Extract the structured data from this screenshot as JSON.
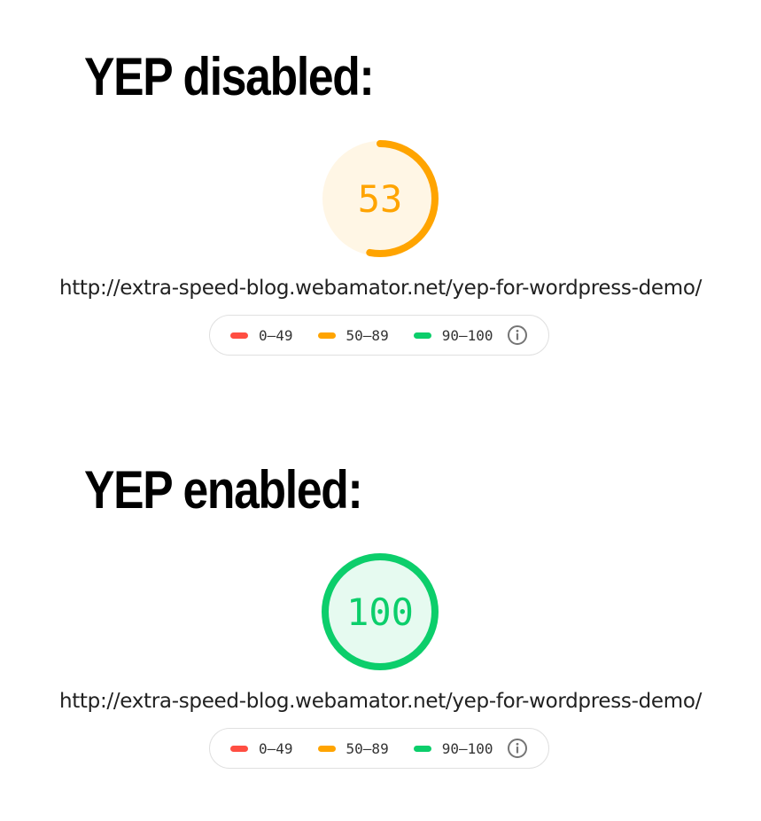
{
  "colors": {
    "fail": "#ff4e42",
    "average": "#ffa400",
    "pass": "#0cce6b",
    "text": "#212121"
  },
  "reports": [
    {
      "heading": "YEP disabled:",
      "score": "53",
      "score_fraction": 0.53,
      "score_status": "average",
      "url": "http://extra-speed-blog.webamator.net/yep-for-wordpress-demo/"
    },
    {
      "heading": "YEP enabled:",
      "score": "100",
      "score_fraction": 1.0,
      "score_status": "pass",
      "url": "http://extra-speed-blog.webamator.net/yep-for-wordpress-demo/"
    }
  ],
  "legend": {
    "ranges": [
      {
        "label": "0–49",
        "status": "fail"
      },
      {
        "label": "50–89",
        "status": "average"
      },
      {
        "label": "90–100",
        "status": "pass"
      }
    ],
    "info_icon": "info-circle-icon"
  }
}
